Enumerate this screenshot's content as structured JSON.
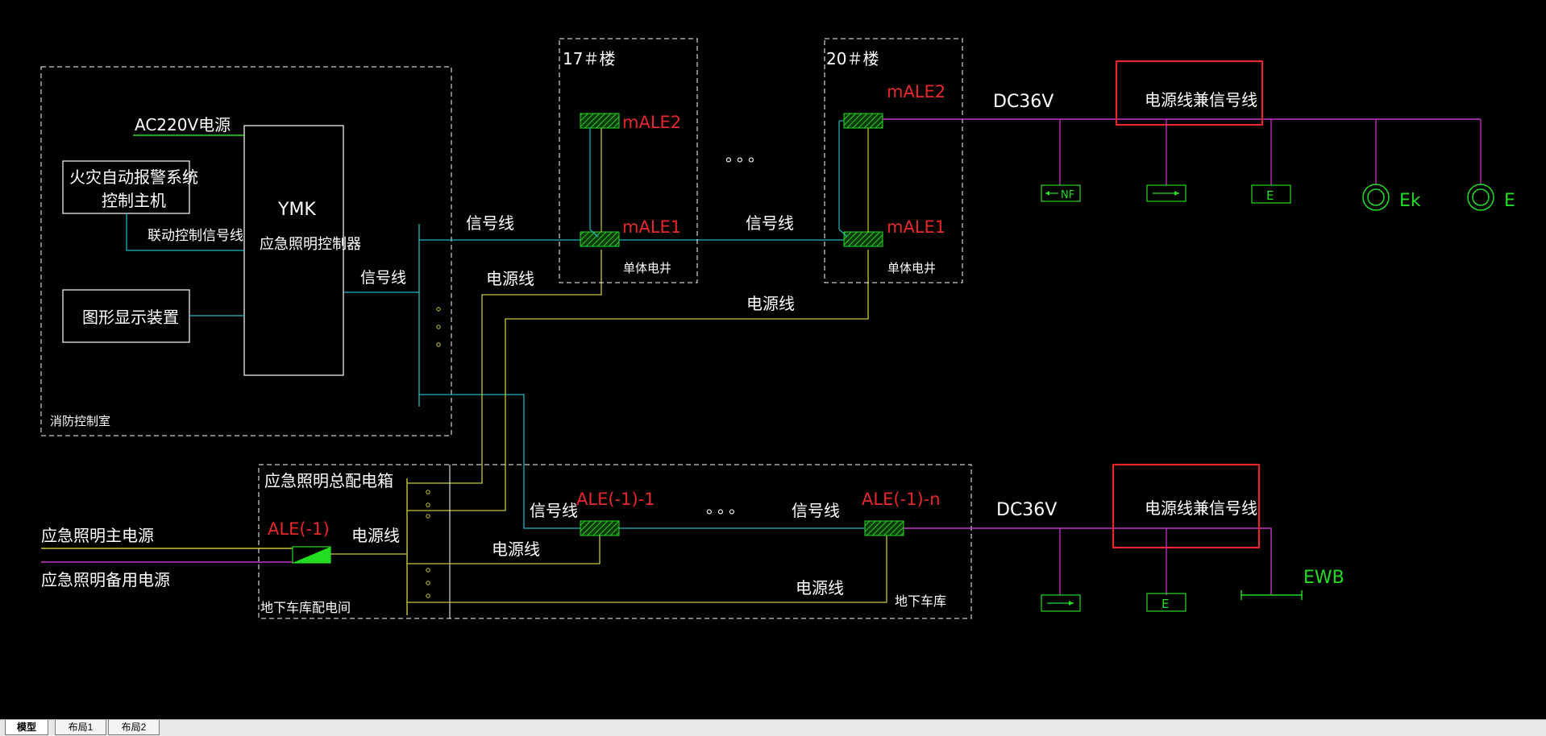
{
  "colors": {
    "background": "#000000",
    "frame": "#ffffff",
    "signal_line": "#1fb6c1",
    "power_line": "#c8c832",
    "dc_line": "#c832c8",
    "label_red": "#e8272a",
    "symbol_green": "#22dd22",
    "highlight_box": "#e8272a"
  },
  "fire_control_room": {
    "area_label": "消防控制室",
    "ac_source": "AC220V电源",
    "alarm_host_line1": "火灾自动报警系统",
    "alarm_host_line2": "控制主机",
    "link_signal": "联动控制信号线",
    "graphic_display": "图形显示装置",
    "controller_code": "YMK",
    "controller_name": "应急照明控制器",
    "signal_out": "信号线"
  },
  "building_17": {
    "title": "17＃楼",
    "box_upper": "mALE2",
    "box_lower": "mALE1",
    "shaft": "单体电井"
  },
  "building_20": {
    "title": "20＃楼",
    "box_upper": "mALE2",
    "box_lower": "mALE1",
    "shaft": "单体电井"
  },
  "wiring": {
    "signal_a": "信号线",
    "signal_b": "信号线",
    "power_a": "电源线",
    "power_b": "电源线",
    "ellipsis": "。。。"
  },
  "upper_dc": {
    "voltage": "DC36V",
    "highlight": "电源线兼信号线",
    "device_nf": "NF",
    "device_e": "E",
    "device_ek_label": "Ek",
    "device_e2_label": "E"
  },
  "distribution": {
    "panel_title": "应急照明总配电箱",
    "main_source": "应急照明主电源",
    "backup_source": "应急照明备用电源",
    "ale_main": "ALE(-1)",
    "power_label": "电源线",
    "room": "地下车库配电间",
    "ale_1": "ALE(-1)-1",
    "ale_n": "ALE(-1)-n",
    "signal_1": "信号线",
    "signal_2": "信号线",
    "power_1": "电源线",
    "power_2": "电源线",
    "garage": "地下车库",
    "ellipsis": "。。。"
  },
  "lower_dc": {
    "voltage": "DC36V",
    "highlight": "电源线兼信号线",
    "device_e": "E",
    "ewb": "EWB"
  },
  "tabs": [
    "模型",
    "布局1",
    "布局2"
  ]
}
